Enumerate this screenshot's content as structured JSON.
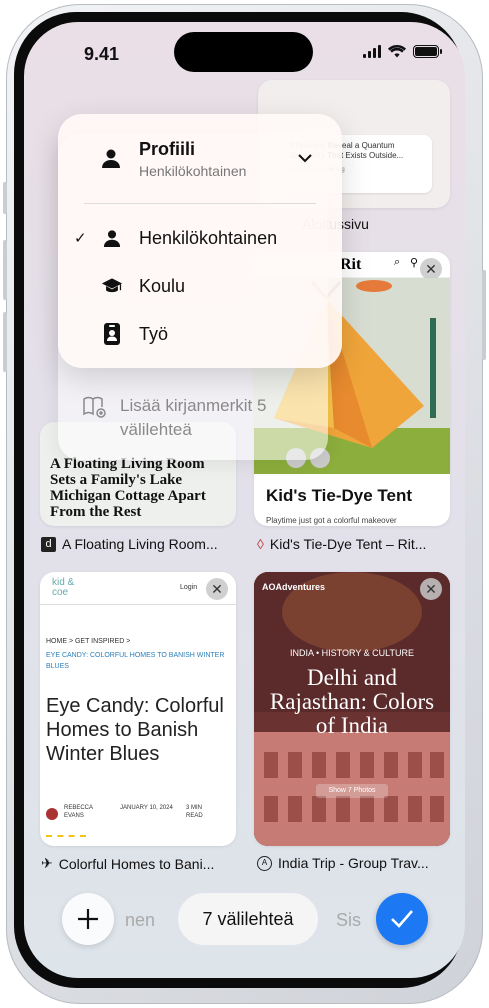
{
  "status": {
    "time": "9.41"
  },
  "menu": {
    "title": "Profiili",
    "subtitle": "Henkilökohtainen",
    "items": [
      {
        "label": "Henkilökohtainen",
        "checked": true,
        "icon": "person-icon"
      },
      {
        "label": "Koulu",
        "checked": false,
        "icon": "graduation-cap-icon"
      },
      {
        "label": "Työ",
        "checked": false,
        "icon": "id-badge-icon"
      }
    ]
  },
  "bookmarks": {
    "add_label": "Lisää kirjanmerkit 5 välilehteä"
  },
  "tabs": {
    "start": {
      "title": "Aloitussivu",
      "article": "Physicists Reveal a Quantum Geometry That Exists Outside...",
      "source": "quantamagazine.org"
    },
    "living": {
      "headline": "A Floating Living Room Sets a Family's Lake Michigan Cottage Apart From the Rest",
      "title": "A Floating Living Room..."
    },
    "tent": {
      "brand": "Rit",
      "headline": "Kid's Tie-Dye Tent",
      "body": "Playtime just got a colorful makeover",
      "title": "Kid's Tie-Dye Tent – Rit..."
    },
    "colorful": {
      "logo": "kid & coe",
      "login": "Login",
      "crumbs": "HOME  >  GET INSPIRED  >",
      "category": "EYE CANDY: COLORFUL HOMES TO BANISH WINTER BLUES",
      "headline": "Eye Candy: Colorful Homes to Banish Winter Blues",
      "author": "REBECCA EVANS",
      "date": "JANUARY 10, 2024",
      "read": "3 MIN READ",
      "title": "Colorful Homes to Bani..."
    },
    "india": {
      "brand": "AOAdventures",
      "tags": "INDIA  •  HISTORY & CULTURE",
      "headline": "Delhi and Rajasthan: Colors of India",
      "photos": "Show 7 Photos",
      "title": "India Trip - Group Trav..."
    }
  },
  "bottom": {
    "tab_count": "7 välilehteä",
    "left_fade": "nen",
    "right_fade": "Sis"
  },
  "colors": {
    "accent": "#1c78f3"
  }
}
